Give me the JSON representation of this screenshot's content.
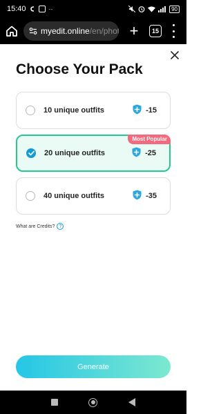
{
  "status_bar": {
    "time": "15:40",
    "battery": "90",
    "icons": [
      "signal-icon",
      "notification-icon",
      "mute-icon",
      "alarm-icon",
      "wifi-icon",
      "cellular-icon",
      "battery-icon"
    ]
  },
  "browser": {
    "url_host": "myedit.online",
    "url_path": "/en/phot",
    "tab_count": "15"
  },
  "dialog": {
    "title": "Choose Your Pack",
    "packs": [
      {
        "label": "10 unique outfits",
        "credits": "-15",
        "selected": false
      },
      {
        "label": "20 unique outfits",
        "credits": "-25",
        "selected": true,
        "badge": "Most Popular"
      },
      {
        "label": "40 unique outfits",
        "credits": "-35",
        "selected": false
      }
    ],
    "credits_link": "What are Credits?",
    "generate_label": "Generate"
  },
  "colors": {
    "accent_green": "#25c98d",
    "accent_blue": "#149bd6",
    "badge_pink": "#f26a7d",
    "button_gradient_start": "#25c6e6",
    "button_gradient_end": "#7de8d0"
  }
}
